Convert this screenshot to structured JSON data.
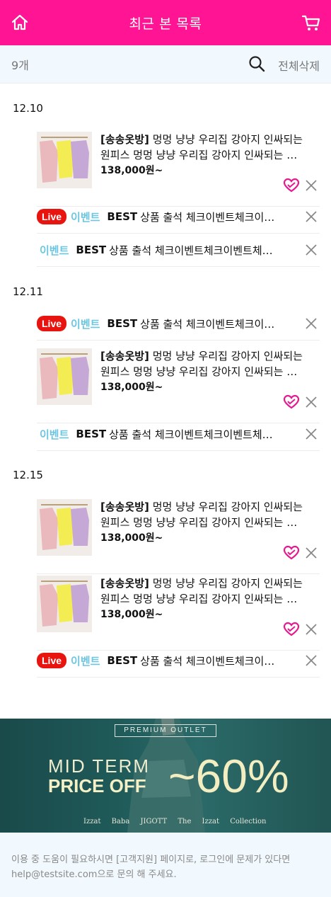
{
  "header": {
    "title": "최근 본 목록",
    "home_icon": "home-icon",
    "cart_icon": "cart-icon",
    "bg_color": "#ff1493"
  },
  "toolbar": {
    "count": "9개",
    "delete_all": "전체삭제",
    "search_icon": "search-icon"
  },
  "product": {
    "shop": "[송송옷방]",
    "desc": "멍멍 냥냥 우리집 강아지 인싸되는 원피스 멍멍 냥냥 우리집 강아지 인싸되는 원피스",
    "price": "138,000원~"
  },
  "event": {
    "live": "Live",
    "label": "이벤트",
    "best": "BEST",
    "text": "상품 출석 체크이벤트체크이벤트체크이벤트"
  },
  "groups": [
    {
      "date": "12.10"
    },
    {
      "date": "12.11"
    },
    {
      "date": "12.15"
    }
  ],
  "banner": {
    "badge": "PREMIUM OUTLET",
    "line1": "MID TERM",
    "line2": "PRICE OFF",
    "discount": "~60%",
    "brands": "Izzat Baba   JIGOTT   The Izzat Collection"
  },
  "footer": {
    "notice": "이용 중 도움이 필요하시면 [고객지원] 페이지로, 로그인에 문제가 있다면 help@testsite.com으로 문의 해 주세요."
  }
}
